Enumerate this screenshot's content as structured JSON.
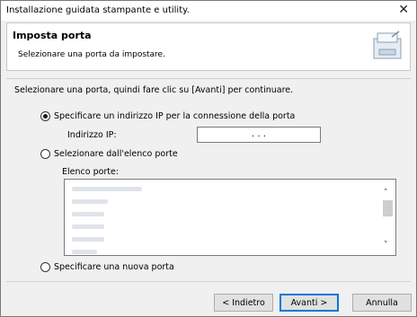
{
  "window": {
    "title": "Installazione guidata stampante e utility.",
    "close_glyph": "✕"
  },
  "header": {
    "title": "Imposta porta",
    "subtitle": "Selezionare una porta da impostare.",
    "icon": "printer-port-icon"
  },
  "instruction": "Selezionare una porta, quindi fare clic su [Avanti] per continuare.",
  "options": {
    "ip": {
      "label": "Specificare un indirizzo IP per la connessione della porta",
      "selected": true
    },
    "ip_field_label": "Indirizzo IP:",
    "ip_value": ". . .",
    "list": {
      "label": "Selezionare dall'elenco porte",
      "selected": false
    },
    "list_label": "Elenco porte:",
    "new": {
      "label": "Specificare una nuova porta",
      "selected": false
    }
  },
  "port_list": {
    "item_count": 6,
    "scroll_up": "˄",
    "scroll_down": "˅"
  },
  "buttons": {
    "back": "< Indietro",
    "next": "Avanti >",
    "cancel": "Annulla"
  },
  "colors": {
    "accent": "#0078d7",
    "dialog_bg": "#f0f0f0"
  }
}
